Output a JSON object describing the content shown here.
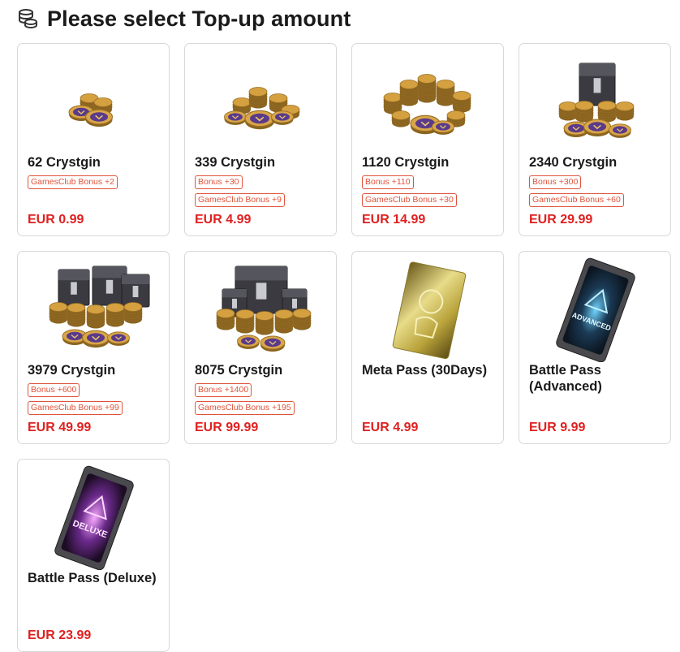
{
  "header": {
    "title": "Please select Top-up amount",
    "icon": "coins-stack-icon"
  },
  "products": [
    {
      "name": "62 Crystgin",
      "badges": [
        "GamesClub Bonus +2"
      ],
      "price": "EUR 0.99",
      "image": "coin-pile-small"
    },
    {
      "name": "339 Crystgin",
      "badges": [
        "Bonus +30",
        "GamesClub Bonus +9"
      ],
      "price": "EUR 4.99",
      "image": "coin-pile-medium"
    },
    {
      "name": "1120 Crystgin",
      "badges": [
        "Bonus +110",
        "GamesClub Bonus +30"
      ],
      "price": "EUR 14.99",
      "image": "coin-pile-large"
    },
    {
      "name": "2340 Crystgin",
      "badges": [
        "Bonus +300",
        "GamesClub Bonus +60"
      ],
      "price": "EUR 29.99",
      "image": "coin-box"
    },
    {
      "name": "3979 Crystgin",
      "badges": [
        "Bonus +600",
        "GamesClub Bonus +99"
      ],
      "price": "EUR 49.99",
      "image": "coin-boxes"
    },
    {
      "name": "8075 Crystgin",
      "badges": [
        "Bonus +1400",
        "GamesClub Bonus +195"
      ],
      "price": "EUR 99.99",
      "image": "coin-vault"
    },
    {
      "name": "Meta Pass (30Days)",
      "badges": [],
      "price": "EUR 4.99",
      "image": "meta-pass-card"
    },
    {
      "name": "Battle Pass (Advanced)",
      "badges": [],
      "price": "EUR 9.99",
      "image": "battle-pass-advanced-card",
      "card_label": "ADVANCED"
    },
    {
      "name": "Battle Pass (Deluxe)",
      "badges": [],
      "price": "EUR 23.99",
      "image": "battle-pass-deluxe-card",
      "card_label": "DELUXE"
    }
  ],
  "colors": {
    "price": "#e02020",
    "badge": "#e0533a",
    "card_border": "#d8d8d8"
  }
}
